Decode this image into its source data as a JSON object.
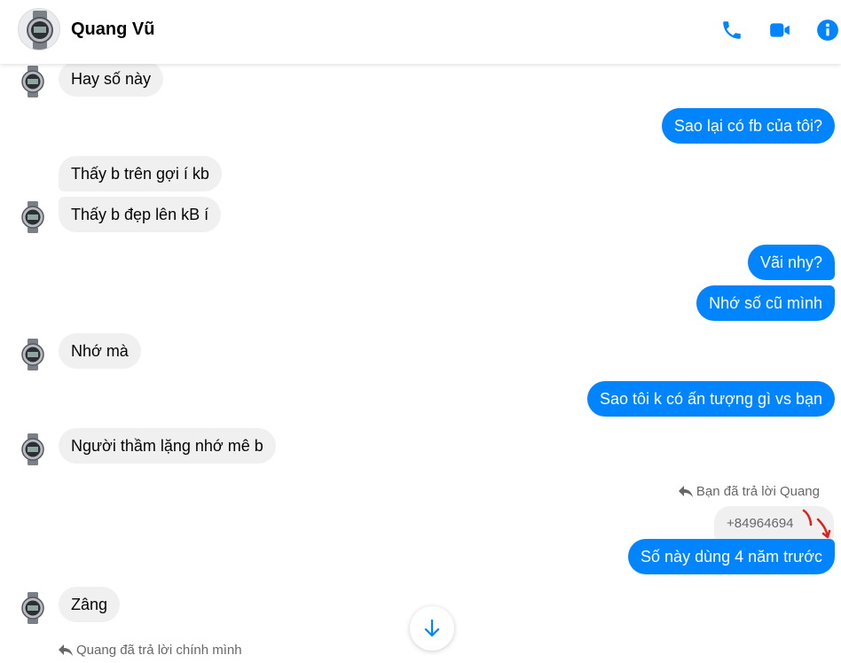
{
  "header": {
    "contact_name": "Quang Vũ",
    "call_icon": "phone-icon",
    "video_icon": "video-camera-icon",
    "info_icon": "info-icon",
    "accent": "#0084ff"
  },
  "messages": [
    {
      "side": "in",
      "text": "Hay số này"
    },
    {
      "side": "out",
      "text": "Sao lại có fb của tôi?"
    },
    {
      "side": "in",
      "text": "Thấy b trên gợi í kb"
    },
    {
      "side": "in",
      "text": "Thấy b đẹp lên kB í"
    },
    {
      "side": "out",
      "text": "Vãi nhy?"
    },
    {
      "side": "out",
      "text": "Nhớ số cũ mình"
    },
    {
      "side": "in",
      "text": "Nhớ mà"
    },
    {
      "side": "out",
      "text": "Sao tôi k có ấn tượng gì vs bạn"
    },
    {
      "side": "in",
      "text": "Người thầm lặng nhớ mê b"
    },
    {
      "side": "out",
      "text": "Số này dùng 4 năm trước"
    },
    {
      "side": "in",
      "text": "Zâng"
    }
  ],
  "reply_context": {
    "outgoing_note": "Bạn đã trả lời Quang",
    "quoted_text": "+84964694",
    "incoming_note": "Quang đã trả lời chính mình"
  },
  "colors": {
    "incoming_bubble": "#f0f0f0",
    "outgoing_bubble": "#0084ff",
    "annotation_stroke": "#e0201b"
  }
}
